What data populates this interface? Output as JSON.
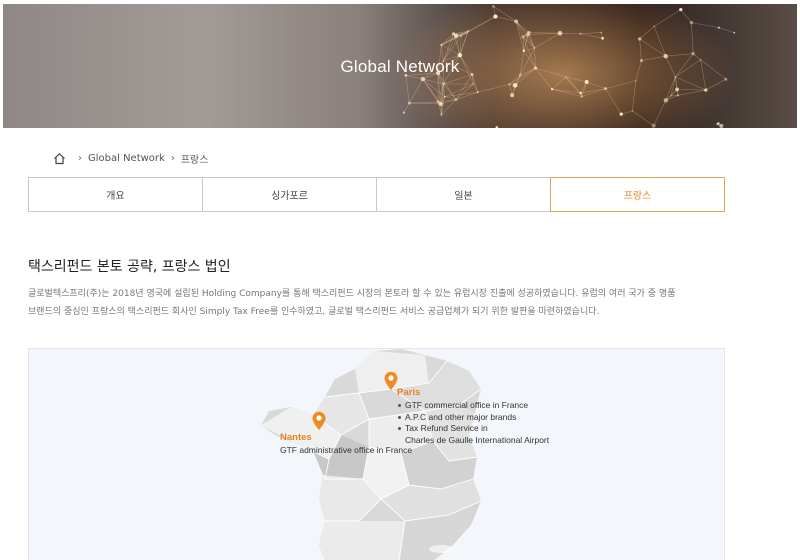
{
  "hero": {
    "title": "Global Network"
  },
  "breadcrumb": {
    "items": [
      "Global Network",
      "프랑스"
    ]
  },
  "tabs": [
    {
      "label": "개요",
      "active": false
    },
    {
      "label": "싱가포르",
      "active": false
    },
    {
      "label": "일본",
      "active": false
    },
    {
      "label": "프랑스",
      "active": true
    }
  ],
  "section": {
    "title": "택스리펀드 본토 공략, 프랑스 법인",
    "description_line1": "글로벌텍스프리(주)는 2018년 영국에 설립된 Holding Company를 통해 택스리펀드 시장의 본토라 할 수 있는 유럽시장 진출에 성공하였습니다. 유럽의 여러 국가 중 명품",
    "description_line2": "브랜드의 중심인 프랑스의 택스리펀드 회사인 Simply Tax Free를 인수하였고, 글로벌 택스리펀드 서비스 공급업체가 되기 위한 발판을 마련하였습니다."
  },
  "map": {
    "paris": {
      "name": "Paris",
      "items": [
        "GTF commercial office in France",
        "A.P.C and other major brands",
        "Tax Refund Service in"
      ],
      "items_cont": "Charles de Gaulle International Airport"
    },
    "nantes": {
      "name": "Nantes",
      "info": "GTF administrative office in France"
    }
  },
  "colors": {
    "accent": "#e8821e",
    "active_tab_border": "#e0a35a"
  },
  "icons": {
    "home": "home-icon",
    "separator": "chevron-right-icon",
    "pin": "map-pin-icon"
  }
}
